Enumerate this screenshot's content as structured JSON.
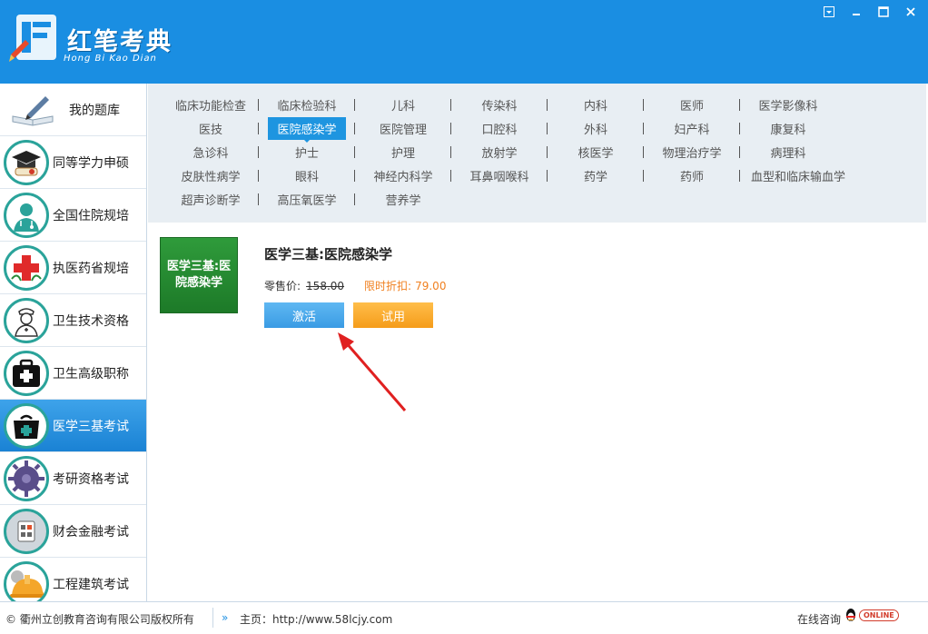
{
  "app": {
    "brand_title": "红笔考典",
    "brand_subtitle": "Hong Bi Kao Dian"
  },
  "window_controls": [
    "menu-icon",
    "minimize-icon",
    "maximize-icon",
    "close-icon"
  ],
  "sidebar": {
    "items": [
      {
        "label": "我的题库",
        "icon": "pen-book-icon"
      },
      {
        "label": "同等学力申硕",
        "icon": "graduation-cap-icon"
      },
      {
        "label": "全国住院规培",
        "icon": "doctor-icon"
      },
      {
        "label": "执医药省规培",
        "icon": "red-cross-icon"
      },
      {
        "label": "卫生技术资格",
        "icon": "nurse-icon"
      },
      {
        "label": "卫生高级职称",
        "icon": "medical-kit-icon"
      },
      {
        "label": "医学三基考试",
        "icon": "medical-bag-icon",
        "active": true
      },
      {
        "label": "考研资格考试",
        "icon": "gears-icon"
      },
      {
        "label": "财会金融考试",
        "icon": "calculator-icon"
      },
      {
        "label": "工程建筑考试",
        "icon": "helmet-icon"
      }
    ]
  },
  "subjects": {
    "rows": [
      [
        "临床功能检查",
        "临床检验科",
        "儿科",
        "传染科",
        "内科",
        "医师",
        "医学影像科"
      ],
      [
        "医技",
        "医院感染学",
        "医院管理",
        "口腔科",
        "外科",
        "妇产科",
        "康复科"
      ],
      [
        "急诊科",
        "护士",
        "护理",
        "放射学",
        "核医学",
        "物理治疗学",
        "病理科"
      ],
      [
        "皮肤性病学",
        "眼科",
        "神经内科学",
        "耳鼻咽喉科",
        "药学",
        "药师",
        "血型和临床输血学"
      ],
      [
        "超声诊断学",
        "高压氧医学",
        "营养学"
      ]
    ],
    "active": "医院感染学"
  },
  "product": {
    "thumb_text": "医学三基:医院感染学",
    "title": "医学三基:医院感染学",
    "retail_label": "零售价:",
    "retail_price": "158.00",
    "sale_label": "限时折扣:",
    "sale_price": "79.00",
    "activate_label": "激活",
    "trial_label": "试用"
  },
  "footer": {
    "copyright": "© 衢州立创教育咨询有限公司版权所有",
    "home_label": "主页：http://www.58lcjy.com",
    "online_label": "在线咨询",
    "online_badge": "ONLINE"
  },
  "colors": {
    "header": "#1a8ee2",
    "active_subject": "#1e95e0",
    "activate_button": "#3a9be4",
    "trial_button": "#f59c1a",
    "sale_text": "#f08020",
    "thumb_green": "#2f9b3b",
    "arrow": "#e02020"
  }
}
